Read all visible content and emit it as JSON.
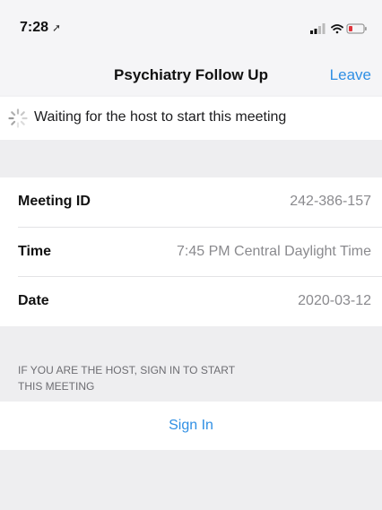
{
  "status_bar": {
    "time": "7:28",
    "location_icon": "location-arrow-icon",
    "signal_icon": "cellular-signal-icon",
    "wifi_icon": "wifi-icon",
    "battery_icon": "battery-low-icon",
    "battery_color": "#e0343c"
  },
  "nav": {
    "title": "Psychiatry Follow Up",
    "leave_label": "Leave"
  },
  "waiting": {
    "icon": "spinner-icon",
    "text": "Waiting for the host to start this meeting"
  },
  "meeting_info": {
    "rows": [
      {
        "label": "Meeting ID",
        "value": "242-386-157"
      },
      {
        "label": "Time",
        "value": "7:45 PM Central Daylight Time"
      },
      {
        "label": "Date",
        "value": "2020-03-12"
      }
    ]
  },
  "host_note": {
    "line1": "IF YOU ARE THE HOST, SIGN IN TO START",
    "line2": "THIS MEETING"
  },
  "sign_in": {
    "label": "Sign In"
  },
  "colors": {
    "accent": "#2f8fe4",
    "background": "#f2f2f4"
  }
}
